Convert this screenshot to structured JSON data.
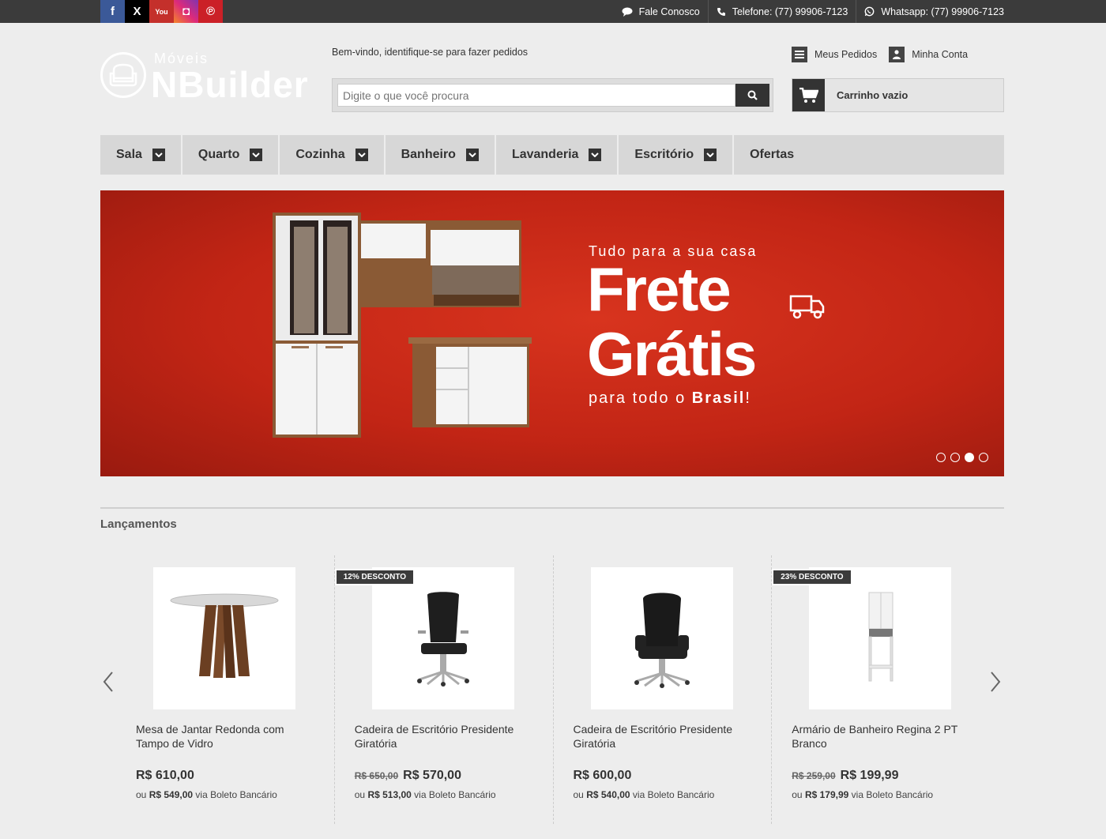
{
  "social": [
    {
      "name": "facebook",
      "glyph": "f"
    },
    {
      "name": "x",
      "glyph": "X"
    },
    {
      "name": "youtube",
      "glyph": "You"
    },
    {
      "name": "instagram",
      "glyph": "◘"
    },
    {
      "name": "pinterest",
      "glyph": "℗"
    }
  ],
  "topbar": {
    "contact": "Fale Conosco",
    "phone": "Telefone: (77) 99906-7123",
    "whatsapp": "Whatsapp: (77) 99906-7123"
  },
  "logo": {
    "small": "Móveis",
    "big": "NBuilder"
  },
  "header": {
    "welcome": "Bem-vindo, identifique-se para fazer pedidos",
    "search_placeholder": "Digite o que você procura",
    "orders": "Meus Pedidos",
    "account": "Minha Conta",
    "cart": "Carrinho vazio"
  },
  "nav": [
    {
      "label": "Sala",
      "dropdown": true
    },
    {
      "label": "Quarto",
      "dropdown": true
    },
    {
      "label": "Cozinha",
      "dropdown": true
    },
    {
      "label": "Banheiro",
      "dropdown": true
    },
    {
      "label": "Lavanderia",
      "dropdown": true
    },
    {
      "label": "Escritório",
      "dropdown": true
    },
    {
      "label": "Ofertas",
      "dropdown": false
    }
  ],
  "banner": {
    "subtitle": "Tudo para a sua casa",
    "line1": "Frete",
    "line2": "Grátis",
    "footer_pre": "para todo o ",
    "footer_bold": "Brasil",
    "footer_post": "!",
    "active_slide": 3,
    "slide_count": 4
  },
  "section": {
    "title": "Lançamentos"
  },
  "products": [
    {
      "name": "Mesa de Jantar Redonda com Tampo de Vidro",
      "badge": "",
      "old_price": "",
      "price": "R$ 610,00",
      "boleto_pre": "ou ",
      "boleto_price": "R$ 549,00",
      "boleto_post": " via Boleto Bancário",
      "icon": "table-image"
    },
    {
      "name": "Cadeira de Escritório Presidente Giratória",
      "badge": "12% DESCONTO",
      "old_price": "R$ 650,00",
      "price": "R$ 570,00",
      "boleto_pre": "ou ",
      "boleto_price": "R$ 513,00",
      "boleto_post": " via Boleto Bancário",
      "icon": "chair-image"
    },
    {
      "name": "Cadeira de Escritório Presidente Giratória",
      "badge": "",
      "old_price": "",
      "price": "R$ 600,00",
      "boleto_pre": "ou ",
      "boleto_price": "R$ 540,00",
      "boleto_post": " via Boleto Bancário",
      "icon": "chair-image"
    },
    {
      "name": "Armário de Banheiro Regina 2 PT Branco",
      "badge": "23% DESCONTO",
      "old_price": "R$ 259,00",
      "price": "R$ 199,99",
      "boleto_pre": "ou ",
      "boleto_price": "R$ 179,99",
      "boleto_post": " via Boleto Bancário",
      "icon": "cabinet-image"
    }
  ],
  "colors": {
    "topbar": "#3b3b3b",
    "banner": "#c22515",
    "nav": "#d7d7d7"
  }
}
